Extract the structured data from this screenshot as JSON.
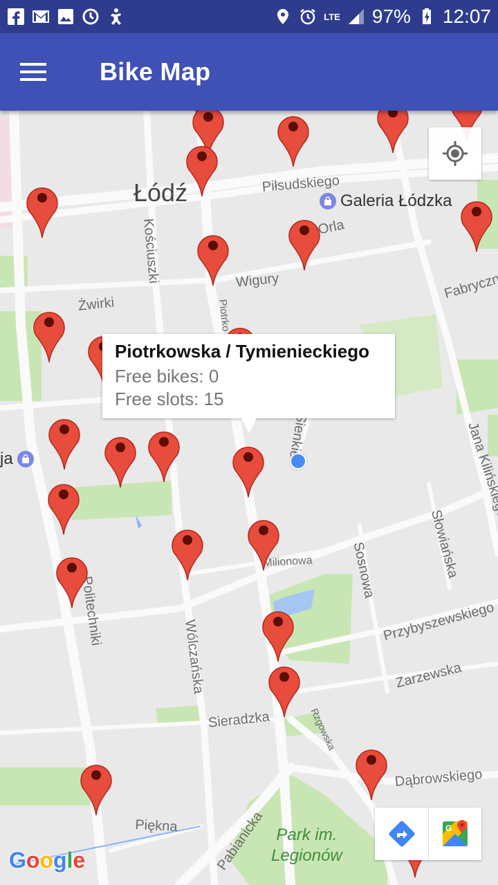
{
  "status_bar": {
    "battery": "97%",
    "time": "12:07",
    "network": "LTE",
    "icons": [
      "facebook-icon",
      "gmail-icon",
      "gallery-icon",
      "sync-icon",
      "accessibility-icon",
      "location-icon",
      "alarm-icon",
      "signal-icon",
      "battery-icon"
    ]
  },
  "app_bar": {
    "title": "Bike Map",
    "menu_icon": "hamburger-menu-icon"
  },
  "map": {
    "city": "Łódź",
    "poi": {
      "label": "Galeria Łódzka",
      "icon": "shopping-bag-icon"
    },
    "poi_partial": {
      "label": "ja",
      "icon": "shopping-bag-icon"
    },
    "park": "Park im.\nLegionów",
    "streets": {
      "pilsudskiego": "Piłsudskiego",
      "kosciuszki": "Kościuszki",
      "wigury": "Wigury",
      "zwirki": "Żwirki",
      "piotrkowska": "Piotrko",
      "orla": "Orla",
      "fabryczna": "Fabryczn",
      "sienkiewicza": "Sienkie",
      "kilinskiego": "Jana Kilińskiego",
      "slowianska": "Słowiańska",
      "sosnowa": "Sosnowa",
      "milionowa": "Milionowa",
      "politechniki": "Politechniki",
      "przybyszewskiego": "Przybyszewskiego",
      "wolczanska": "Wólczańska",
      "zarzewska": "Zarzewska",
      "sieradzka": "Sieradzka",
      "rzgowska": "Rzgowska",
      "dabrowskiego": "Dąbrowskiego",
      "piekna": "Piękna",
      "pabianicka": "Pabianicka"
    },
    "accent_marker_color": "#e74c3c",
    "accent_marker_stroke": "#b3281c",
    "my_location_color": "#4a8af4"
  },
  "info_window": {
    "title": "Piotrkowska / Tymienieckiego",
    "free_bikes": "Free bikes: 0",
    "free_slots": "Free slots: 15"
  },
  "controls": {
    "my_location_icon": "crosshair-icon",
    "directions_icon": "directions-icon",
    "open_maps_icon": "google-maps-icon"
  },
  "attribution": "Google"
}
